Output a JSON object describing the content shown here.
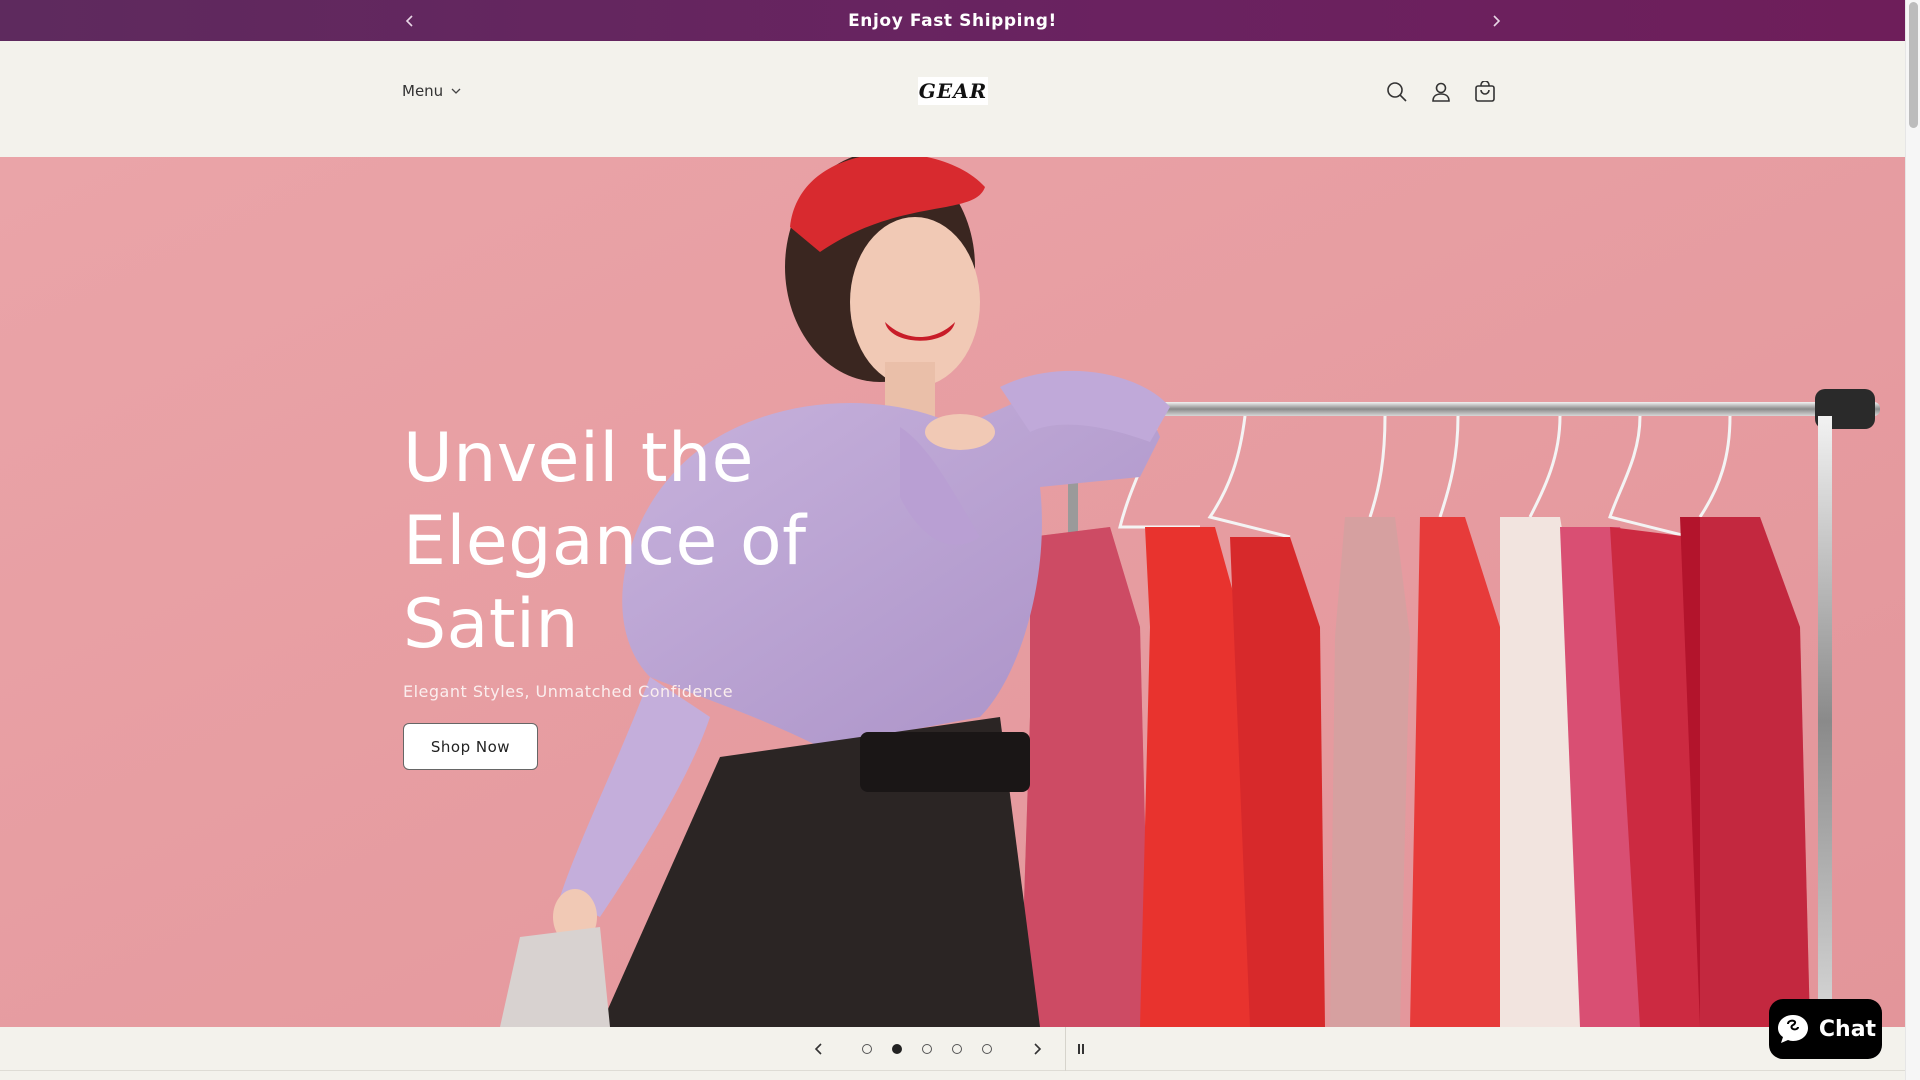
{
  "announcement": {
    "message": "Enjoy Fast Shipping!",
    "prev_icon": "chevron-left-icon",
    "next_icon": "chevron-right-icon"
  },
  "header": {
    "menu_label": "Menu",
    "logo_text": "GEAR",
    "icons": [
      "search-icon",
      "account-icon",
      "cart-icon"
    ]
  },
  "hero": {
    "title_lines": [
      "Unveil the",
      "Elegance of",
      "Satin"
    ],
    "subtitle": "Elegant Styles, Unmatched Confidence",
    "button_label": "Shop Now"
  },
  "slideshow": {
    "slide_count": 5,
    "active_slide": 2,
    "icons": [
      "chevron-left-icon",
      "chevron-right-icon",
      "pause-icon"
    ]
  },
  "chat": {
    "label": "Chat"
  },
  "colors": {
    "announcement_bg": "#6a2260",
    "page_bg": "#f3f2ec",
    "hero_bg": "#e9a0a4",
    "chat_bg": "#000000"
  }
}
